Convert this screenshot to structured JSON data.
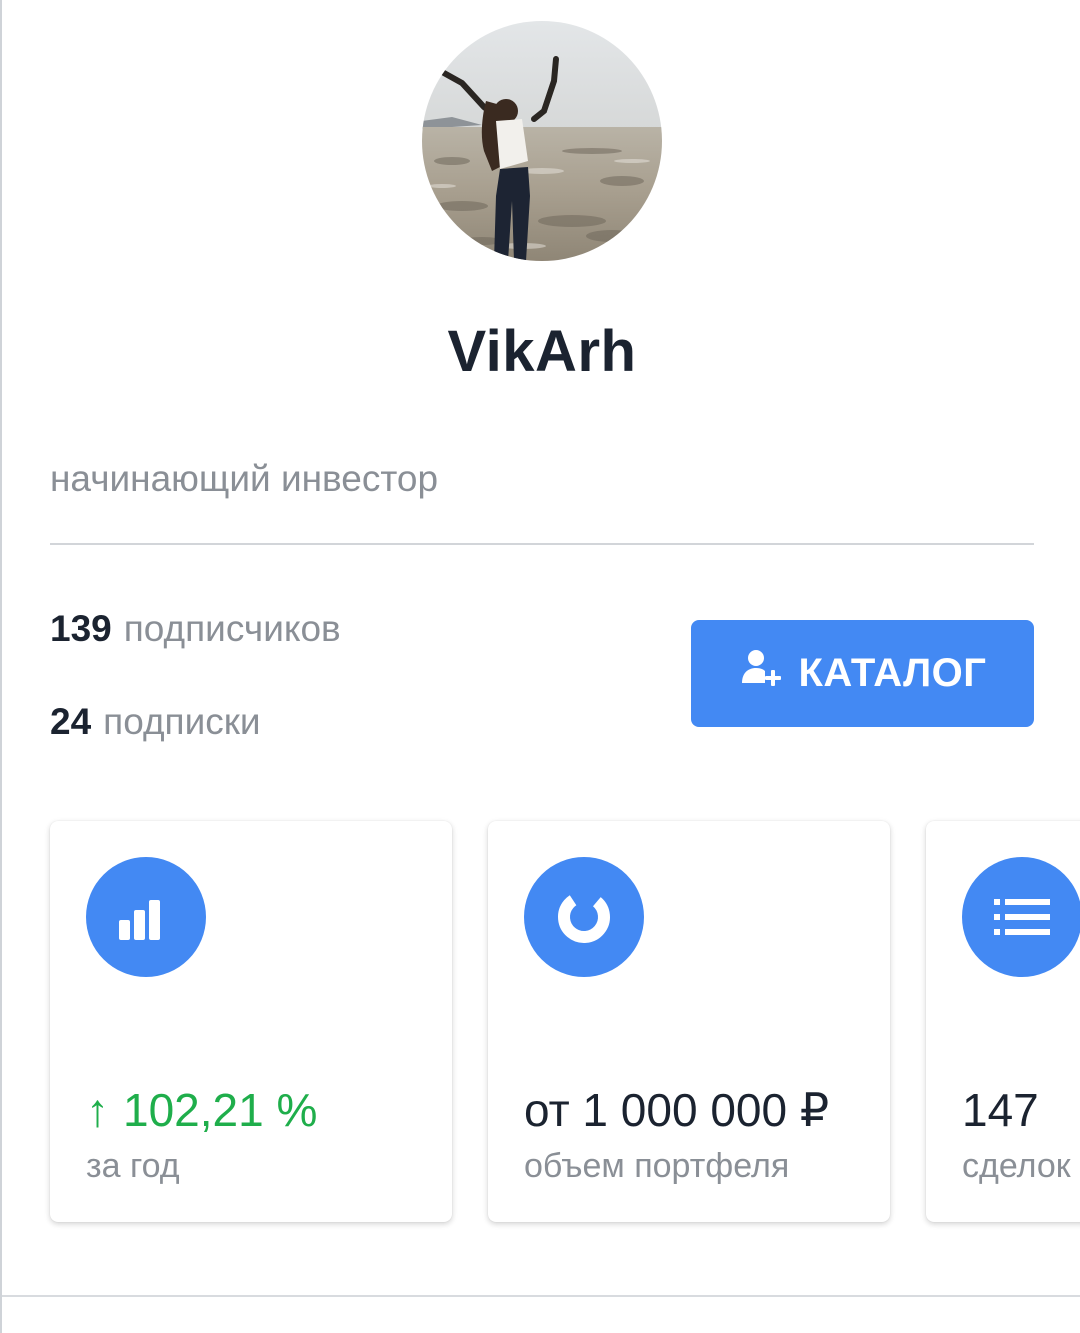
{
  "profile": {
    "username": "VikArh",
    "bio": "начинающий инвестор",
    "avatar_icon": "user-avatar-photo"
  },
  "stats": {
    "followers_count": "139",
    "followers_label": "подписчиков",
    "following_count": "24",
    "following_label": "подписки"
  },
  "catalog_button": {
    "label": "КАТАЛОГ",
    "icon": "add-user-icon"
  },
  "cards": [
    {
      "icon": "bar-chart-icon",
      "arrow": "↑",
      "value": "102,21 %",
      "label": "за год"
    },
    {
      "icon": "donut-chart-icon",
      "value": "от 1 000 000 ₽",
      "label": "объем портфеля"
    },
    {
      "icon": "list-icon",
      "value": "147",
      "label": "сделок"
    }
  ],
  "colors": {
    "accent": "#4389f3",
    "positive": "#1fae4b",
    "muted_text": "#8a8f96",
    "primary_text": "#1b2330"
  }
}
